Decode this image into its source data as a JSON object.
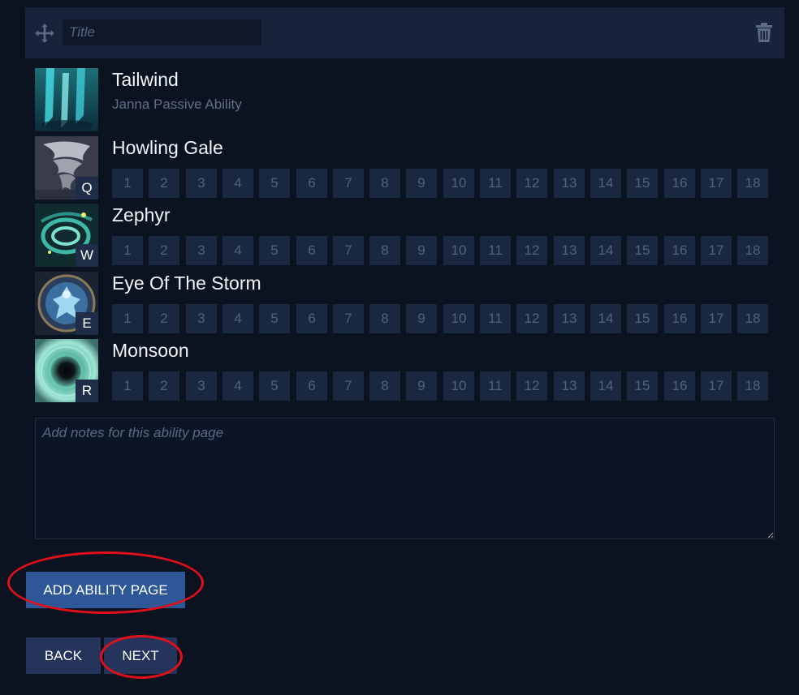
{
  "header": {
    "title_placeholder": "Title"
  },
  "abilities": [
    {
      "name": "Tailwind",
      "subtitle": "Janna Passive Ability",
      "key": ""
    },
    {
      "name": "Howling Gale",
      "key": "Q"
    },
    {
      "name": "Zephyr",
      "key": "W"
    },
    {
      "name": "Eye Of The Storm",
      "key": "E"
    },
    {
      "name": "Monsoon",
      "key": "R"
    }
  ],
  "levels": [
    "1",
    "2",
    "3",
    "4",
    "5",
    "6",
    "7",
    "8",
    "9",
    "10",
    "11",
    "12",
    "13",
    "14",
    "15",
    "16",
    "17",
    "18"
  ],
  "notes": {
    "placeholder": "Add notes for this ability page"
  },
  "buttons": {
    "add_ability_page": "ADD ABILITY PAGE",
    "back": "BACK",
    "next": "NEXT"
  },
  "colors": {
    "background": "#0b1220",
    "panel": "#17233a",
    "level_box": "#1a2740",
    "primary_button": "#2d5797",
    "secondary_button": "#25345a",
    "annotation_red": "#e0101a"
  },
  "icons": {
    "drag": "move-arrows-icon",
    "delete": "trash-icon"
  }
}
